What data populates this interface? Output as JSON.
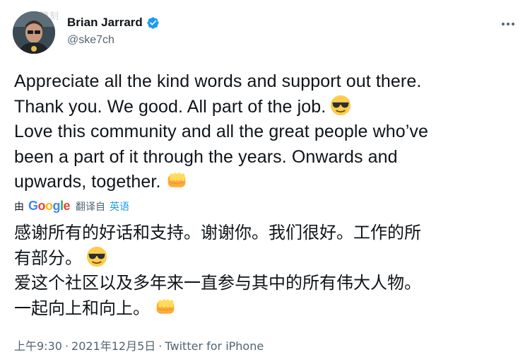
{
  "watermark": "雕刻",
  "author": {
    "display_name": "Brian Jarrard",
    "handle": "@ske7ch",
    "verified": true
  },
  "tweet": {
    "lines": [
      "Appreciate all the kind words and support out there.",
      "Thank you. We good. All part of the job.",
      "Love this community and all the great people who’ve",
      "been a part of it through the years. Onwards and",
      "upwards, together."
    ]
  },
  "translation": {
    "by_label": "由",
    "provider": "Google",
    "translated_from": "翻译自",
    "source_language": "英语",
    "lines": [
      "感谢所有的好话和支持。谢谢你。我们很好。工作的所",
      "有部分。",
      "爱这个社区以及多年来一直参与其中的所有伟大人物。",
      "一起向上和向上。"
    ]
  },
  "meta": {
    "time": "上午9:30",
    "separator": "·",
    "date": "2021年12月5日",
    "source": "Twitter for iPhone"
  },
  "icons": {
    "verified": "verified-badge-icon",
    "emoji_1": "sunglasses-emoji",
    "emoji_2": "fist-emoji",
    "more": "more-icon"
  },
  "colors": {
    "verified": "#1d9bf0",
    "text": "#0f1419",
    "secondary": "#536471",
    "link": "#1d9bf0"
  }
}
